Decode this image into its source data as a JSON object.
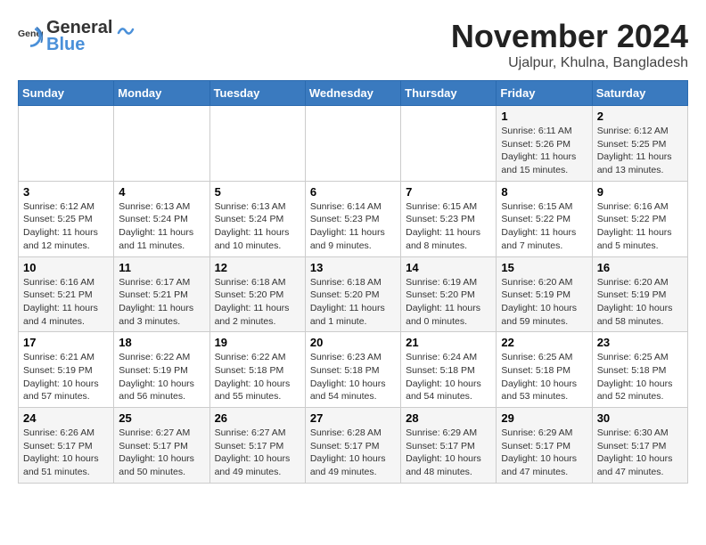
{
  "header": {
    "logo_general": "General",
    "logo_blue": "Blue",
    "month_title": "November 2024",
    "location": "Ujalpur, Khulna, Bangladesh"
  },
  "weekdays": [
    "Sunday",
    "Monday",
    "Tuesday",
    "Wednesday",
    "Thursday",
    "Friday",
    "Saturday"
  ],
  "weeks": [
    [
      {
        "day": "",
        "info": ""
      },
      {
        "day": "",
        "info": ""
      },
      {
        "day": "",
        "info": ""
      },
      {
        "day": "",
        "info": ""
      },
      {
        "day": "",
        "info": ""
      },
      {
        "day": "1",
        "info": "Sunrise: 6:11 AM\nSunset: 5:26 PM\nDaylight: 11 hours\nand 15 minutes."
      },
      {
        "day": "2",
        "info": "Sunrise: 6:12 AM\nSunset: 5:25 PM\nDaylight: 11 hours\nand 13 minutes."
      }
    ],
    [
      {
        "day": "3",
        "info": "Sunrise: 6:12 AM\nSunset: 5:25 PM\nDaylight: 11 hours\nand 12 minutes."
      },
      {
        "day": "4",
        "info": "Sunrise: 6:13 AM\nSunset: 5:24 PM\nDaylight: 11 hours\nand 11 minutes."
      },
      {
        "day": "5",
        "info": "Sunrise: 6:13 AM\nSunset: 5:24 PM\nDaylight: 11 hours\nand 10 minutes."
      },
      {
        "day": "6",
        "info": "Sunrise: 6:14 AM\nSunset: 5:23 PM\nDaylight: 11 hours\nand 9 minutes."
      },
      {
        "day": "7",
        "info": "Sunrise: 6:15 AM\nSunset: 5:23 PM\nDaylight: 11 hours\nand 8 minutes."
      },
      {
        "day": "8",
        "info": "Sunrise: 6:15 AM\nSunset: 5:22 PM\nDaylight: 11 hours\nand 7 minutes."
      },
      {
        "day": "9",
        "info": "Sunrise: 6:16 AM\nSunset: 5:22 PM\nDaylight: 11 hours\nand 5 minutes."
      }
    ],
    [
      {
        "day": "10",
        "info": "Sunrise: 6:16 AM\nSunset: 5:21 PM\nDaylight: 11 hours\nand 4 minutes."
      },
      {
        "day": "11",
        "info": "Sunrise: 6:17 AM\nSunset: 5:21 PM\nDaylight: 11 hours\nand 3 minutes."
      },
      {
        "day": "12",
        "info": "Sunrise: 6:18 AM\nSunset: 5:20 PM\nDaylight: 11 hours\nand 2 minutes."
      },
      {
        "day": "13",
        "info": "Sunrise: 6:18 AM\nSunset: 5:20 PM\nDaylight: 11 hours\nand 1 minute."
      },
      {
        "day": "14",
        "info": "Sunrise: 6:19 AM\nSunset: 5:20 PM\nDaylight: 11 hours\nand 0 minutes."
      },
      {
        "day": "15",
        "info": "Sunrise: 6:20 AM\nSunset: 5:19 PM\nDaylight: 10 hours\nand 59 minutes."
      },
      {
        "day": "16",
        "info": "Sunrise: 6:20 AM\nSunset: 5:19 PM\nDaylight: 10 hours\nand 58 minutes."
      }
    ],
    [
      {
        "day": "17",
        "info": "Sunrise: 6:21 AM\nSunset: 5:19 PM\nDaylight: 10 hours\nand 57 minutes."
      },
      {
        "day": "18",
        "info": "Sunrise: 6:22 AM\nSunset: 5:19 PM\nDaylight: 10 hours\nand 56 minutes."
      },
      {
        "day": "19",
        "info": "Sunrise: 6:22 AM\nSunset: 5:18 PM\nDaylight: 10 hours\nand 55 minutes."
      },
      {
        "day": "20",
        "info": "Sunrise: 6:23 AM\nSunset: 5:18 PM\nDaylight: 10 hours\nand 54 minutes."
      },
      {
        "day": "21",
        "info": "Sunrise: 6:24 AM\nSunset: 5:18 PM\nDaylight: 10 hours\nand 54 minutes."
      },
      {
        "day": "22",
        "info": "Sunrise: 6:25 AM\nSunset: 5:18 PM\nDaylight: 10 hours\nand 53 minutes."
      },
      {
        "day": "23",
        "info": "Sunrise: 6:25 AM\nSunset: 5:18 PM\nDaylight: 10 hours\nand 52 minutes."
      }
    ],
    [
      {
        "day": "24",
        "info": "Sunrise: 6:26 AM\nSunset: 5:17 PM\nDaylight: 10 hours\nand 51 minutes."
      },
      {
        "day": "25",
        "info": "Sunrise: 6:27 AM\nSunset: 5:17 PM\nDaylight: 10 hours\nand 50 minutes."
      },
      {
        "day": "26",
        "info": "Sunrise: 6:27 AM\nSunset: 5:17 PM\nDaylight: 10 hours\nand 49 minutes."
      },
      {
        "day": "27",
        "info": "Sunrise: 6:28 AM\nSunset: 5:17 PM\nDaylight: 10 hours\nand 49 minutes."
      },
      {
        "day": "28",
        "info": "Sunrise: 6:29 AM\nSunset: 5:17 PM\nDaylight: 10 hours\nand 48 minutes."
      },
      {
        "day": "29",
        "info": "Sunrise: 6:29 AM\nSunset: 5:17 PM\nDaylight: 10 hours\nand 47 minutes."
      },
      {
        "day": "30",
        "info": "Sunrise: 6:30 AM\nSunset: 5:17 PM\nDaylight: 10 hours\nand 47 minutes."
      }
    ]
  ]
}
